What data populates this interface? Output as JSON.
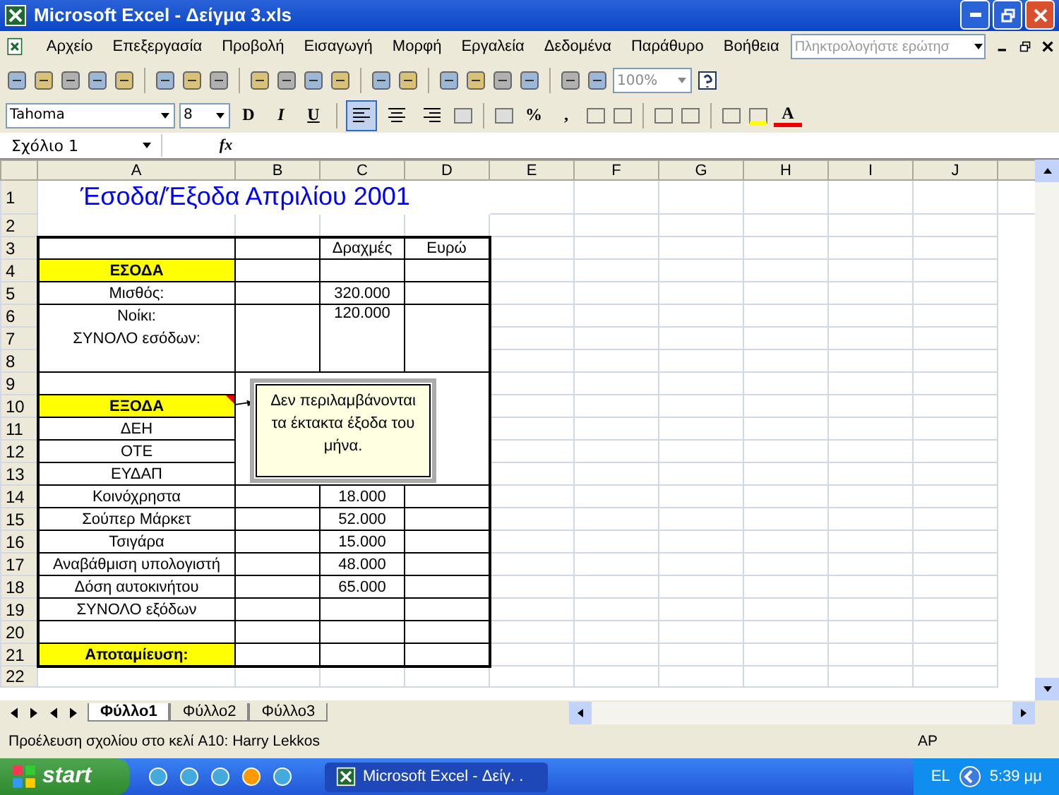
{
  "window": {
    "title": "Microsoft Excel - Δείγμα 3.xls"
  },
  "menu": [
    "Αρχείο",
    "Επεξεργασία",
    "Προβολή",
    "Εισαγωγή",
    "Μορφή",
    "Εργαλεία",
    "Δεδομένα",
    "Παράθυρο",
    "Βοήθεια"
  ],
  "help_box": {
    "placeholder": "Πληκτρολογήστε ερώτησ"
  },
  "standard_toolbar": {
    "zoom": "100%"
  },
  "format_toolbar": {
    "font": "Tahoma",
    "size": "8",
    "bold": "D",
    "italic": "I",
    "underline": "U",
    "percent": "%",
    "comma": ",",
    "font_color": "A",
    "alignments": [
      {
        "selected": true
      },
      {
        "selected": false
      },
      {
        "selected": false
      }
    ]
  },
  "formula_bar": {
    "name_box": "Σχόλιο 1",
    "fx": "fx"
  },
  "columns": [
    "A",
    "B",
    "C",
    "D",
    "E",
    "F",
    "G",
    "H",
    "I",
    "J"
  ],
  "rows": [
    {
      "header": "1",
      "kind": "title",
      "a": "Έσοδα/Έξοδα Απριλίου 2001"
    },
    {
      "header": "2",
      "kind": "blank"
    },
    {
      "header": "3",
      "kind": "header",
      "c": "Δραχμές",
      "d": "Ευρώ"
    },
    {
      "header": "4",
      "kind": "section",
      "a": "ΕΣΟΔΑ"
    },
    {
      "header": "5",
      "kind": "item",
      "a": "Μισθός:",
      "c": "320.000"
    },
    {
      "header": "6",
      "kind": "tall",
      "a": "Νοίκι:",
      "a2": "ΣΥΝΟΛΟ εσόδων:",
      "c": "120.000"
    },
    {
      "header": "7",
      "kind": "merged"
    },
    {
      "header": "8",
      "kind": "merged"
    },
    {
      "header": "9",
      "kind": "item"
    },
    {
      "header": "10",
      "kind": "section",
      "a": "ΕΞΟΔΑ",
      "has_comment": true
    },
    {
      "header": "11",
      "kind": "item",
      "a": "ΔΕΗ"
    },
    {
      "header": "12",
      "kind": "item",
      "a": "ΟΤΕ"
    },
    {
      "header": "13",
      "kind": "item",
      "a": "ΕΥΔΑΠ"
    },
    {
      "header": "14",
      "kind": "item",
      "a": "Κοινόχρηστα",
      "c": "18.000"
    },
    {
      "header": "15",
      "kind": "item",
      "a": "Σούπερ Μάρκετ",
      "c": "52.000"
    },
    {
      "header": "16",
      "kind": "item",
      "a": "Τσιγάρα",
      "c": "15.000"
    },
    {
      "header": "17",
      "kind": "item",
      "a": "Αναβάθμιση υπολογιστή",
      "c": "48.000"
    },
    {
      "header": "18",
      "kind": "item",
      "a": "Δόση αυτοκινήτου",
      "c": "65.000"
    },
    {
      "header": "19",
      "kind": "item",
      "a": "ΣΥΝΟΛΟ εξόδων"
    },
    {
      "header": "20",
      "kind": "item"
    },
    {
      "header": "21",
      "kind": "result",
      "a": "Αποταμίευση:"
    },
    {
      "header": "22",
      "kind": "blank"
    }
  ],
  "comment": {
    "text": "Δεν περιλαμβάνονται τα έκτακτα έξοδα του μήνα."
  },
  "sheet_tabs": [
    {
      "label": "Φύλλο1",
      "selected": true
    },
    {
      "label": "Φύλλο2",
      "selected": false
    },
    {
      "label": "Φύλλο3",
      "selected": false
    }
  ],
  "status_bar": {
    "message": "Προέλευση σχολίου στο κελί A10: Harry Lekkos",
    "indicator": "ΑΡ"
  },
  "taskbar": {
    "start": "start",
    "task": "Microsoft Excel - Δείγ. .",
    "language": "EL",
    "clock": "5:39 μμ"
  }
}
